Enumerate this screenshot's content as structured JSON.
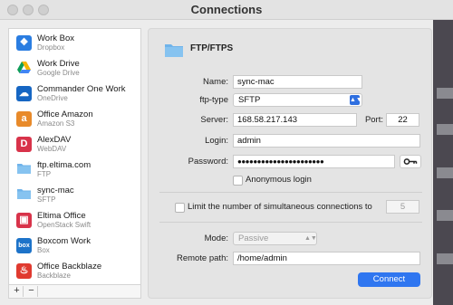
{
  "window": {
    "title": "Connections"
  },
  "sidebar": {
    "items": [
      {
        "name": "Work Box",
        "sub": "Dropbox",
        "icon": "dropbox-icon",
        "color": "#2a7de1",
        "glyph": "❖"
      },
      {
        "name": "Work Drive",
        "sub": "Google Drive",
        "icon": "google-drive-icon",
        "color": "#f2f2f2",
        "glyph": "▲"
      },
      {
        "name": "Commander One Work",
        "sub": "OneDrive",
        "icon": "onedrive-icon",
        "color": "#1666c3",
        "glyph": "☁"
      },
      {
        "name": "Office Amazon",
        "sub": "Amazon S3",
        "icon": "amazon-s3-icon",
        "color": "#e88a2a",
        "glyph": "a"
      },
      {
        "name": "AlexDAV",
        "sub": "WebDAV",
        "icon": "webdav-icon",
        "color": "#d8334a",
        "glyph": "D"
      },
      {
        "name": "ftp.eltima.com",
        "sub": "FTP",
        "icon": "ftp-folder-icon",
        "color": "#6fb3ea",
        "glyph": ""
      },
      {
        "name": "sync-mac",
        "sub": "SFTP",
        "icon": "sftp-folder-icon",
        "color": "#6fb3ea",
        "glyph": ""
      },
      {
        "name": "Eltima Office",
        "sub": "OpenStack Swift",
        "icon": "openstack-icon",
        "color": "#d8334a",
        "glyph": "▣"
      },
      {
        "name": "Boxcom Work",
        "sub": "Box",
        "icon": "box-icon",
        "color": "#1d73c9",
        "glyph": "box"
      },
      {
        "name": "Office Backblaze",
        "sub": "Backblaze",
        "icon": "backblaze-icon",
        "color": "#e03a2f",
        "glyph": "♨"
      }
    ],
    "add_label": "+",
    "remove_label": "−"
  },
  "form": {
    "header": "FTP/FTPS",
    "name_label": "Name:",
    "name_value": "sync-mac",
    "ftptype_label": "ftp-type",
    "ftptype_value": "SFTP",
    "server_label": "Server:",
    "server_value": "168.58.217.143",
    "port_label": "Port:",
    "port_value": "22",
    "login_label": "Login:",
    "login_value": "admin",
    "password_label": "Password:",
    "password_value": "●●●●●●●●●●●●●●●●●●●●●●",
    "anonymous_label": "Anonymous login",
    "limit_label": "Limit the number of simultaneous connections to",
    "limit_value": "5",
    "mode_label": "Mode:",
    "mode_value": "Passive",
    "remote_label": "Remote path:",
    "remote_value": "/home/admin",
    "connect_label": "Connect"
  },
  "colors": {
    "accent": "#2f76f0",
    "folder": "#6fb3ea"
  }
}
